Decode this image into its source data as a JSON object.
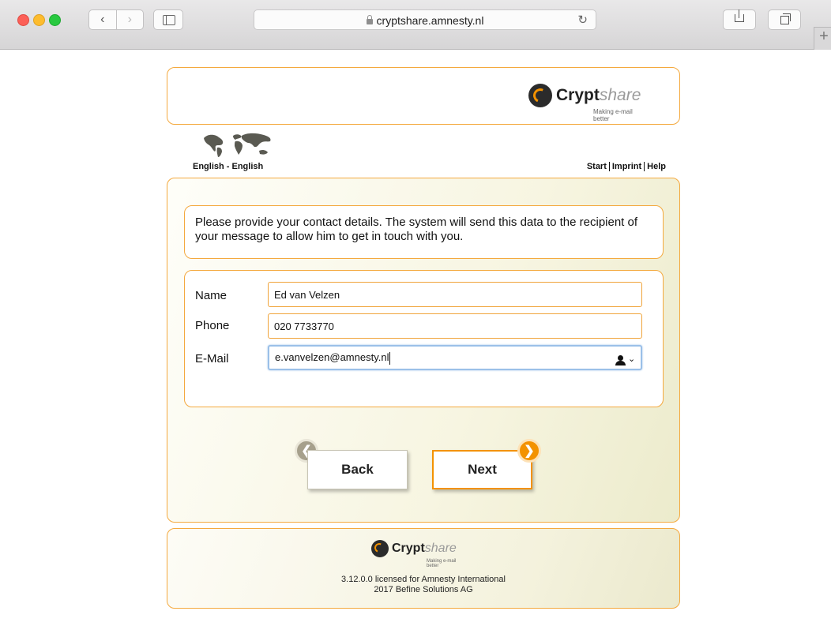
{
  "browser": {
    "url": "cryptshare.amnesty.nl",
    "back_glyph": "‹",
    "forward_glyph": "›",
    "reload_glyph": "↻",
    "new_tab_glyph": "+"
  },
  "header": {
    "logo": {
      "word_bold": "Crypt",
      "word_italic": "share",
      "tagline": "Making e-mail better"
    }
  },
  "language": {
    "label": "English - English"
  },
  "top_links": [
    {
      "label": "Start"
    },
    {
      "label": "Imprint"
    },
    {
      "label": "Help"
    }
  ],
  "info": {
    "text": "Please provide your contact details. The system will send this data to the recipient of your message to allow him to get in touch with you."
  },
  "form": {
    "name": {
      "label": "Name",
      "value": "Ed van Velzen"
    },
    "phone": {
      "label": "Phone",
      "value": "020 7733770"
    },
    "email": {
      "label": "E-Mail",
      "value": "e.vanvelzen@amnesty.nl"
    }
  },
  "buttons": {
    "back": {
      "label": "Back",
      "icon": "left-arrow-icon"
    },
    "next": {
      "label": "Next",
      "icon": "right-arrow-icon"
    }
  },
  "footer": {
    "logo": {
      "word_bold": "Crypt",
      "word_italic": "share",
      "tagline": "Making e-mail better"
    },
    "license": "3.12.0.0 licensed for Amnesty International",
    "copyright": "2017 Befine Solutions AG"
  },
  "colors": {
    "accent": "#f39200",
    "border": "#f4a93e",
    "panel_bg": "#f7f5e1",
    "back_arrow": "#a6a08c"
  }
}
